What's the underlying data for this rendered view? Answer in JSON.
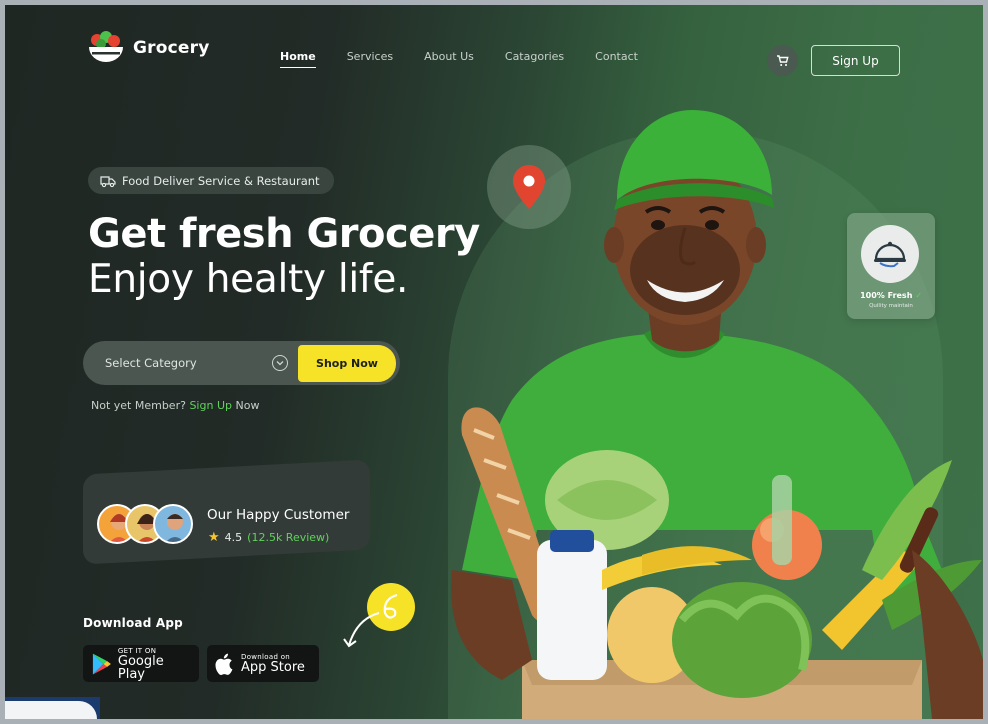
{
  "brand": {
    "name": "Grocery"
  },
  "nav": {
    "items": [
      {
        "label": "Home",
        "active": true
      },
      {
        "label": "Services",
        "active": false
      },
      {
        "label": "About Us",
        "active": false
      },
      {
        "label": "Catagories",
        "active": false
      },
      {
        "label": "Contact",
        "active": false
      }
    ],
    "cart_icon": "cart-icon",
    "signup_label": "Sign Up"
  },
  "hero": {
    "pill_label": "Food Deliver Service & Restaurant",
    "title": "Get fresh Grocery",
    "subtitle": "Enjoy healty life.",
    "search": {
      "select_label": "Select Category",
      "button_label": "Shop Now"
    },
    "member": {
      "prefix": "Not yet Member?",
      "link": "Sign Up",
      "suffix": "Now"
    }
  },
  "customers": {
    "title": "Our Happy Customer",
    "rating": "4.5",
    "reviews": "(12.5k Review)"
  },
  "download": {
    "title": "Download App",
    "google": {
      "small": "GET IT ON",
      "big": "Google Play"
    },
    "apple": {
      "small": "Download on",
      "big": "App Store"
    }
  },
  "fresh_badge": {
    "title": "100% Fresh",
    "subtitle": "Quility maintain"
  },
  "colors": {
    "accent_yellow": "#f6e227",
    "accent_green": "#5fd35b",
    "bg_dark": "#1f2723",
    "bg_green": "#3e7049"
  }
}
